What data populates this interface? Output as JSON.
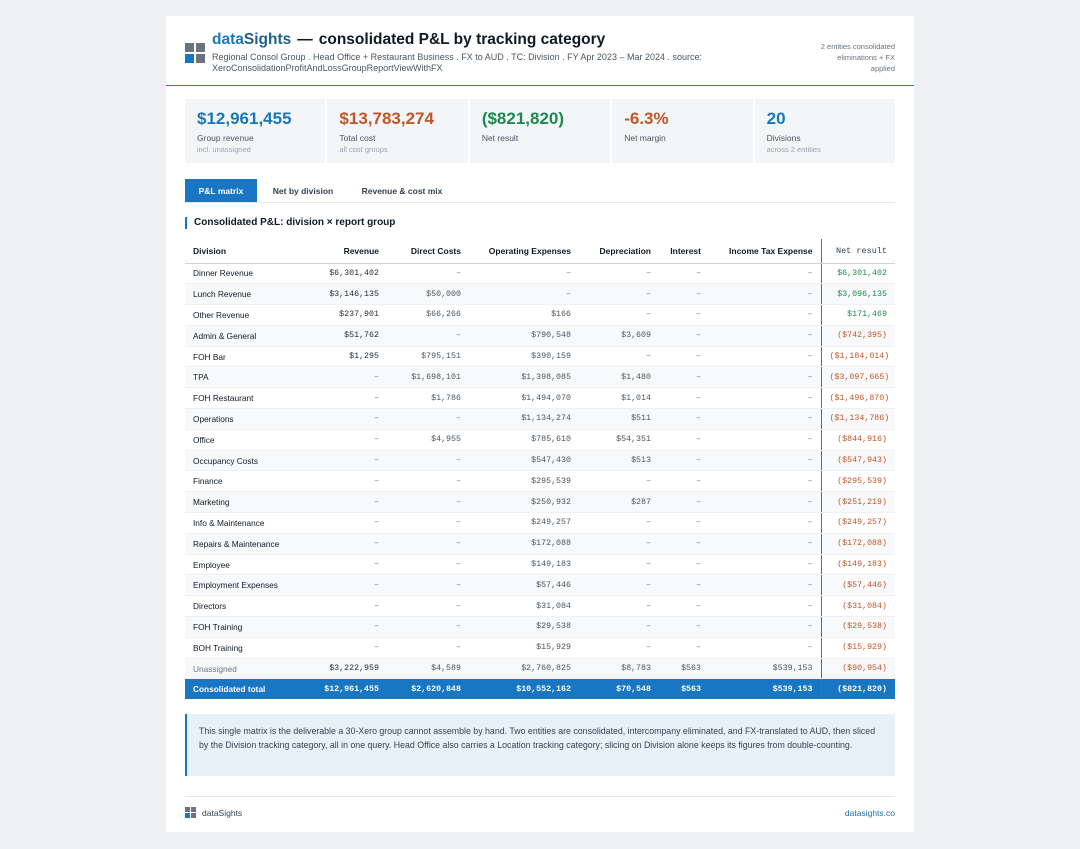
{
  "header": {
    "brand_first": "data",
    "brand_second": "Sights",
    "separator": "—",
    "title": "consolidated P&L by tracking category",
    "subtitle": "Regional Consol Group . Head Office + Restaurant Business . FX to AUD . TC: Division . FY Apr 2023 – Mar 2024 . source: XeroConsolidationProfitAndLossGroupReportViewWithFX",
    "status_line1": "2 entities consolidated",
    "status_line2": "eliminations + FX",
    "status_line3": "applied"
  },
  "kpis": [
    {
      "value": "$12,961,455",
      "label": "Group revenue",
      "sub": "incl. unassigned",
      "color": "#1a78b8"
    },
    {
      "value": "$13,783,274",
      "label": "Total cost",
      "sub": "all cost groups",
      "color": "#c0562a"
    },
    {
      "value": "($821,820)",
      "label": "Net result",
      "sub": "",
      "color": "#1a8a4e"
    },
    {
      "value": "-6.3%",
      "label": "Net margin",
      "sub": "",
      "color": "#c0562a"
    },
    {
      "value": "20",
      "label": "Divisions",
      "sub": "across 2 entities",
      "color": "#1a78b8"
    }
  ],
  "tabs": [
    {
      "label": "P&L matrix",
      "active": true
    },
    {
      "label": "Net by division",
      "active": false
    },
    {
      "label": "Revenue & cost mix",
      "active": false
    }
  ],
  "section_title": "Consolidated P&L: division × report group",
  "table": {
    "columns": [
      "Division",
      "Revenue",
      "Direct Costs",
      "Operating Expenses",
      "Depreciation",
      "Interest",
      "Income Tax Expense",
      "Net result"
    ],
    "rows": [
      [
        "Dinner Revenue",
        "$6,301,402",
        "–",
        "–",
        "–",
        "–",
        "–",
        "$6,301,402"
      ],
      [
        "Lunch Revenue",
        "$3,146,135",
        "$50,000",
        "–",
        "–",
        "–",
        "–",
        "$3,096,135"
      ],
      [
        "Other Revenue",
        "$237,901",
        "$66,266",
        "$166",
        "–",
        "–",
        "–",
        "$171,469"
      ],
      [
        "Admin & General",
        "$51,762",
        "–",
        "$790,548",
        "$3,609",
        "–",
        "–",
        "($742,395)"
      ],
      [
        "FOH Bar",
        "$1,295",
        "$795,151",
        "$390,159",
        "–",
        "–",
        "–",
        "($1,184,014)"
      ],
      [
        "TPA",
        "–",
        "$1,698,101",
        "$1,398,085",
        "$1,480",
        "–",
        "–",
        "($3,097,665)"
      ],
      [
        "FOH Restaurant",
        "–",
        "$1,786",
        "$1,494,070",
        "$1,014",
        "–",
        "–",
        "($1,496,870)"
      ],
      [
        "Operations",
        "–",
        "–",
        "$1,134,274",
        "$511",
        "–",
        "–",
        "($1,134,786)"
      ],
      [
        "Office",
        "–",
        "$4,955",
        "$785,610",
        "$54,351",
        "–",
        "–",
        "($844,916)"
      ],
      [
        "Occupancy Costs",
        "–",
        "–",
        "$547,430",
        "$513",
        "–",
        "–",
        "($547,943)"
      ],
      [
        "Finance",
        "–",
        "–",
        "$295,539",
        "–",
        "–",
        "–",
        "($295,539)"
      ],
      [
        "Marketing",
        "–",
        "–",
        "$250,932",
        "$287",
        "–",
        "–",
        "($251,219)"
      ],
      [
        "Info & Maintenance",
        "–",
        "–",
        "$249,257",
        "–",
        "–",
        "–",
        "($249,257)"
      ],
      [
        "Repairs & Maintenance",
        "–",
        "–",
        "$172,088",
        "–",
        "–",
        "–",
        "($172,088)"
      ],
      [
        "Employee",
        "–",
        "–",
        "$149,183",
        "–",
        "–",
        "–",
        "($149,183)"
      ],
      [
        "Employment Expenses",
        "–",
        "–",
        "$57,446",
        "–",
        "–",
        "–",
        "($57,446)"
      ],
      [
        "Directors",
        "–",
        "–",
        "$31,084",
        "–",
        "–",
        "–",
        "($31,084)"
      ],
      [
        "FOH Training",
        "–",
        "–",
        "$29,538",
        "–",
        "–",
        "–",
        "($29,538)"
      ],
      [
        "BOH Training",
        "–",
        "–",
        "$15,929",
        "–",
        "–",
        "–",
        "($15,929)"
      ],
      [
        "Unassigned",
        "$3,222,959",
        "$4,589",
        "$2,760,825",
        "$8,783",
        "$563",
        "$539,153",
        "($90,954)"
      ]
    ],
    "total": [
      "Consolidated total",
      "$12,961,455",
      "$2,620,848",
      "$10,552,162",
      "$70,548",
      "$563",
      "$539,153",
      "($821,820)"
    ]
  },
  "note": "This single matrix is the deliverable a 30-Xero group cannot assemble by hand. Two entities are consolidated, intercompany eliminated, and FX-translated to AUD, then sliced by the Division tracking category, all in one query. Head Office also carries a Location tracking category; slicing on Division alone keeps its figures from double-counting.",
  "footer": {
    "brand": "dataSights",
    "link": "datasights.co"
  },
  "colors": {
    "accent": "#1976c2",
    "positive": "#1a8a4e",
    "negative": "#c0562a"
  }
}
